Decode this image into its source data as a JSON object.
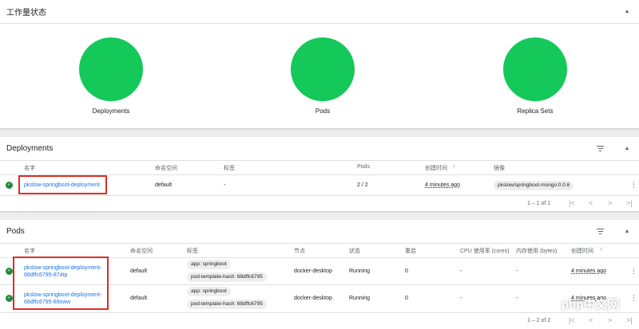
{
  "status": {
    "title": "工作量状态",
    "items": [
      {
        "label": "Deployments"
      },
      {
        "label": "Pods"
      },
      {
        "label": "Replica Sets"
      }
    ],
    "colors": {
      "healthy": "#14c85a"
    }
  },
  "deployments": {
    "title": "Deployments",
    "columns": [
      "名字",
      "命名空间",
      "标签",
      "Pods",
      "创建时间",
      "镜像"
    ],
    "sort_indicator": "↑",
    "rows": [
      {
        "name": "pkslow-springboot-deployment",
        "namespace": "default",
        "labels": "-",
        "pods": "2 / 2",
        "created": "4 minutes ago",
        "image": "pkslow/springboot-mongo:0.0.6"
      }
    ],
    "pagination": "1 – 1 of 1"
  },
  "pods": {
    "title": "Pods",
    "columns": [
      "名字",
      "命名空间",
      "标签",
      "节点",
      "状态",
      "重启",
      "CPU 使用率 (cores)",
      "内存使用 (bytes)",
      "创建时间"
    ],
    "sort_indicator": "↑",
    "rows": [
      {
        "name_line1": "pkslow-springboot-deployment-",
        "name_line2": "68dffc6795-874tp",
        "namespace": "default",
        "label1": "app: springboot",
        "label2": "pod-template-hash: 68dffc6795",
        "node": "docker-desktop",
        "status": "Running",
        "restarts": "0",
        "cpu": "-",
        "memory": "-",
        "created": "4 minutes ago"
      },
      {
        "name_line1": "pkslow-springboot-deployment-",
        "name_line2": "68dffc6795-89xww",
        "namespace": "default",
        "label1": "app: springboot",
        "label2": "pod-template-hash: 68dffc6795",
        "node": "docker-desktop",
        "status": "Running",
        "restarts": "0",
        "cpu": "-",
        "memory": "-",
        "created": "4 minutes ago"
      }
    ],
    "pagination": "1 – 2 of 2"
  },
  "watermark": "php中文网"
}
